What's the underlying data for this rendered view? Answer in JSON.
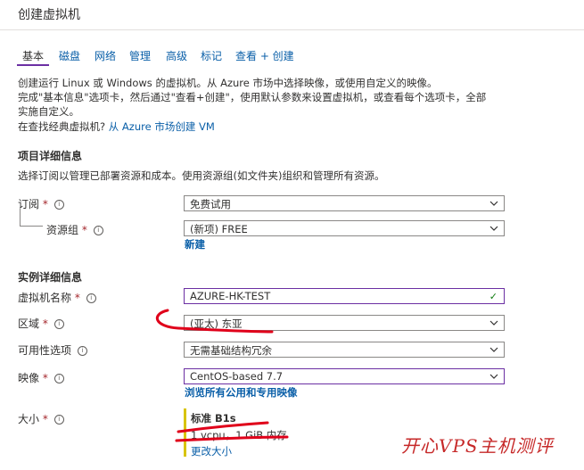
{
  "header": {
    "title": "创建虚拟机"
  },
  "tabs": [
    "基本",
    "磁盘",
    "网络",
    "管理",
    "高级",
    "标记",
    "查看 + 创建"
  ],
  "intro": {
    "line1": "创建运行 Linux 或 Windows 的虚拟机。从 Azure 市场中选择映像，或使用自定义的映像。",
    "line2": "完成\"基本信息\"选项卡，然后通过\"查看+创建\"，使用默认参数来设置虚拟机，或查看每个选项卡，全部",
    "line3": "实施自定义。",
    "classic_question": "在查找经典虚拟机?",
    "classic_link": "从 Azure 市场创建 VM"
  },
  "project": {
    "heading": "项目详细信息",
    "desc": "选择订阅以管理已部署资源和成本。使用资源组(如文件夹)组织和管理所有资源。",
    "subscription_label": "订阅",
    "subscription_value": "免费试用",
    "resource_group_label": "资源组",
    "resource_group_value": "(新项) FREE",
    "create_new": "新建"
  },
  "instance": {
    "heading": "实例详细信息",
    "vm_name_label": "虚拟机名称",
    "vm_name_value": "AZURE-HK-TEST",
    "region_label": "区域",
    "region_value": "(亚太) 东亚",
    "availability_label": "可用性选项",
    "availability_value": "无需基础结构冗余",
    "image_label": "映像",
    "image_value": "CentOS-based 7.7",
    "browse_images": "浏览所有公用和专用映像",
    "size_label": "大小",
    "size_name": "标准 B1s",
    "size_spec": "1 vcpu，1 GiB 内存",
    "change_size": "更改大小"
  },
  "symbols": {
    "required": "*",
    "info": "i",
    "check": "✓"
  },
  "watermark": "开心VPS主机测评",
  "colors": {
    "accent": "#6b2fa3",
    "link": "#0a5fa8",
    "annotation": "#e0001a"
  },
  "icons": [
    "info-icon",
    "chevron-down-icon",
    "checkmark-icon"
  ]
}
